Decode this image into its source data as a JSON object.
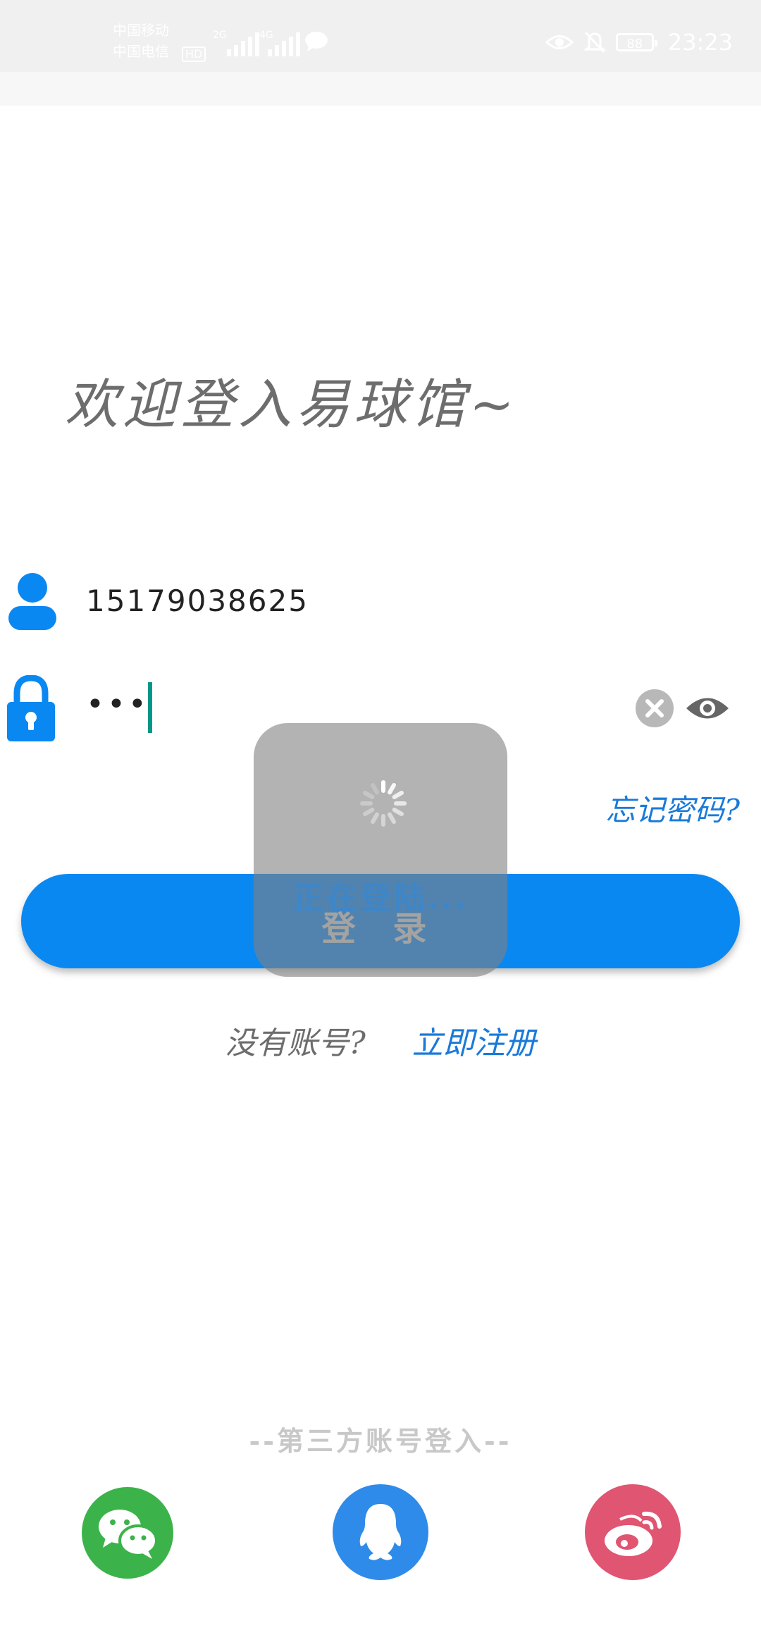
{
  "status_bar": {
    "carrier_1": "中国移动",
    "carrier_2": "中国电信",
    "hd_badge": "HD",
    "network_1": "2G",
    "network_2": "4G",
    "battery": "88",
    "time": "23:23"
  },
  "welcome_text": "欢迎登入易球馆~",
  "login_form": {
    "phone_value": "15179038625",
    "password_value": "•••",
    "forgot_password": "忘记密码?",
    "login_button": "登 录"
  },
  "loading_dialog": {
    "text": "正在登陆..."
  },
  "register": {
    "prompt": "没有账号?",
    "link": "立即注册"
  },
  "third_party": {
    "label": "--第三方账号登入--",
    "icons": [
      "wechat-icon",
      "qq-icon",
      "weibo-icon"
    ]
  },
  "colors": {
    "accent": "#0a88f2",
    "link": "#1a7ad9",
    "wechat": "#3cb34a",
    "qq": "#2f8be9",
    "weibo": "#e05572"
  }
}
